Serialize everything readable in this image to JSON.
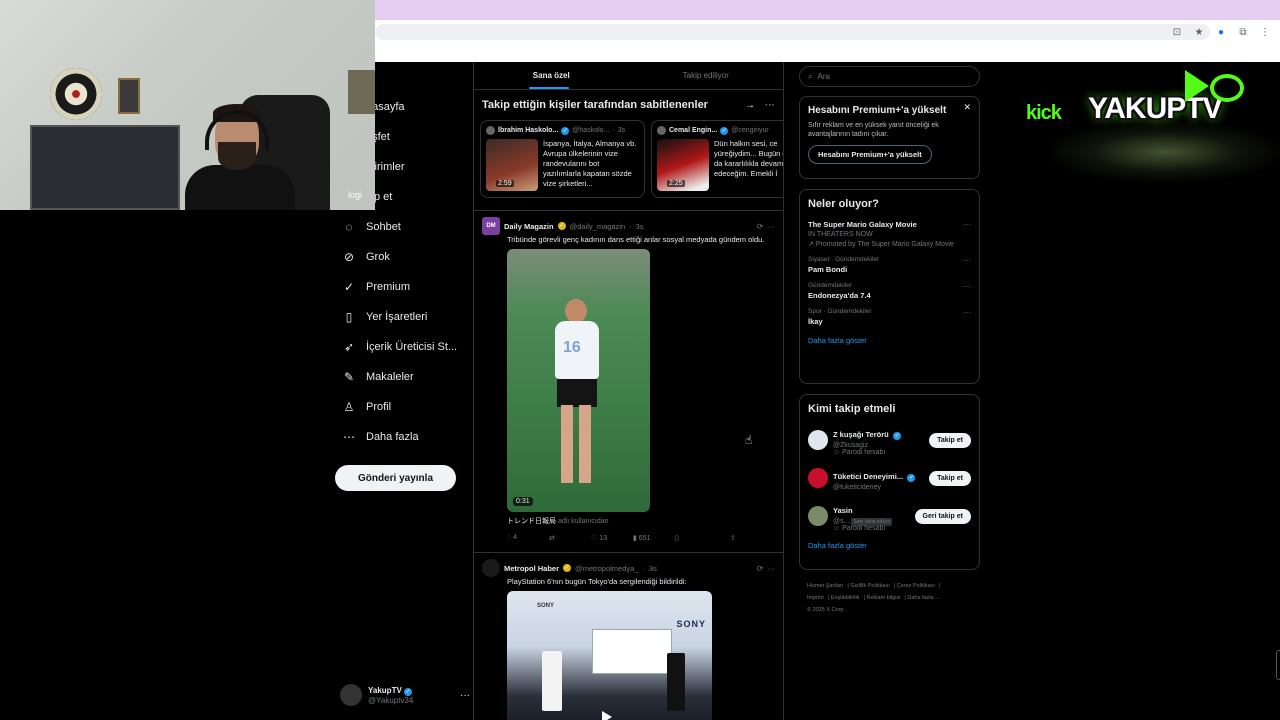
{
  "browser": {
    "icons": [
      "install-icon",
      "star-icon",
      "profile-icon",
      "extensions-icon",
      "tabs-icon"
    ]
  },
  "nav": {
    "items": [
      {
        "label": "Anasayfa",
        "visible_label": "nasayfa",
        "icon": "home-icon"
      },
      {
        "label": "Keşfet",
        "visible_label": "eşfet",
        "icon": "search-icon"
      },
      {
        "label": "Bildirimler",
        "visible_label": "ldirimler",
        "icon": "bell-icon"
      },
      {
        "label": "Takip et",
        "visible_label": "kip et",
        "icon": "follow-icon"
      },
      {
        "label": "Sohbet",
        "visible_label": "Sohbet",
        "icon": "chat-icon"
      },
      {
        "label": "Grok",
        "visible_label": "Grok",
        "icon": "grok-icon"
      },
      {
        "label": "Premium",
        "visible_label": "Premium",
        "icon": "premium-icon"
      },
      {
        "label": "Yer İşaretleri",
        "visible_label": "Yer İşaretleri",
        "icon": "bookmark-icon"
      },
      {
        "label": "İçerik Üreticisi St...",
        "visible_label": "İçerik Üreticisi St...",
        "icon": "rocket-icon"
      },
      {
        "label": "Makaleler",
        "visible_label": "Makaleler",
        "icon": "article-icon"
      },
      {
        "label": "Profil",
        "visible_label": "Profil",
        "icon": "profile-icon"
      },
      {
        "label": "Daha fazla",
        "visible_label": "Daha fazla",
        "icon": "more-circle-icon"
      }
    ],
    "post_button": "Gönderi yayınla",
    "webcam_overlay_text": "logi",
    "me": {
      "name": "YakupTV",
      "handle": "@Yakuptv34"
    }
  },
  "center": {
    "tabs": [
      "Sana özel",
      "Takip ediliyor"
    ],
    "pinned_title": "Takip ettiğin kişiler tarafından sabitlenenler",
    "pinned": [
      {
        "name": "İbrahim Haskolo...",
        "handle": "@haskolo...",
        "time": "3s",
        "text": "İspanya, İtalya, Almanya vb. Avrupa ülkelerinin vize randevularını bot yazılımlarla kapatan sözde vize şirketleri...",
        "duration": "2:59",
        "thumb_color": "#8a3a2a"
      },
      {
        "name": "Cemal Engin...",
        "handle": "@cenginyur",
        "time": "",
        "text": "Dün halkın sesi, ce yüreğiydim... Bugün de yarın da kararlılıkla devam edeceğim. Emekli İ",
        "duration": "2:25",
        "thumb_color": "#b01818"
      }
    ],
    "tweets": [
      {
        "name": "Daily Magazin",
        "handle": "@daily_magazin",
        "time": "3s",
        "avatar_text": "DM",
        "text": "Tribünde görevli genç kadının dans ettiği anlar sosyal medyada gündem oldu.",
        "video_time": "0:31",
        "source": "トレンド日報局",
        "source_suffix": "adlı kullanıcıdan",
        "replies": "4",
        "retweets": "",
        "likes": "13",
        "views": "651",
        "jersey": "16"
      },
      {
        "name": "Metropol Haber",
        "handle": "@metropolmedya_",
        "time": "3s",
        "text": "PlayStation 6'nın bugün Tokyo'da sergilendiği bildirildi:",
        "brand1": "SONY",
        "brand2": "SONY"
      }
    ]
  },
  "right": {
    "search_placeholder": "Ara",
    "premium": {
      "title": "Hesabını Premium+'a yükselt",
      "text": "Sıfır reklam ve en yüksek yanıt önceliği ek avantajlarının tadını çıkar.",
      "button": "Hesabını Premium+'a yükselt"
    },
    "trends_title": "Neler oluyor?",
    "trends": [
      {
        "category": "",
        "title": "The Super Mario Galaxy Movie",
        "sub": "IN THEATERS NOW",
        "promo": "Promoted by The Super Mario Galaxy Movie"
      },
      {
        "category": "Siyaset · Gündemdekiler",
        "title": "Pam Bondi",
        "sub": "",
        "promo": ""
      },
      {
        "category": "Gündemdekiler",
        "title": "Endonezya'da 7.4",
        "sub": "",
        "promo": ""
      },
      {
        "category": "Spor · Gündemdekiler",
        "title": "İkay",
        "sub": "",
        "promo": ""
      }
    ],
    "trends_more": "Daha fazla göster",
    "who_title": "Kimi takip etmeli",
    "who": [
      {
        "name": "Z kuşağı Terörü",
        "handle": "@Zkusagiz",
        "parody": "Parodi hesabı",
        "button": "Takip et",
        "follows_you": "",
        "color": "#dfe6ee"
      },
      {
        "name": "Tüketici Deneyimi...",
        "handle": "@tuketicideney",
        "parody": "",
        "button": "Takip et",
        "follows_you": "",
        "color": "#c8102e"
      },
      {
        "name": "Yasin",
        "handle": "@s...",
        "parody": "Parodi hesabı",
        "button": "Geri takip et",
        "follows_you": "Seni takip ediyor",
        "color": "#7a8b6a"
      }
    ],
    "who_more": "Daha fazla göster",
    "footer": [
      "Hizmet Şartları",
      "Gizlilik Politikası",
      "Çerez Politikası",
      "Imprint",
      "Erişilebilirlik",
      "Reklam bilgisi",
      "Daha fazla ...",
      "© 2025 X Corp."
    ]
  },
  "overlay": {
    "kick": "kick",
    "channel": "YAKUPTV"
  }
}
